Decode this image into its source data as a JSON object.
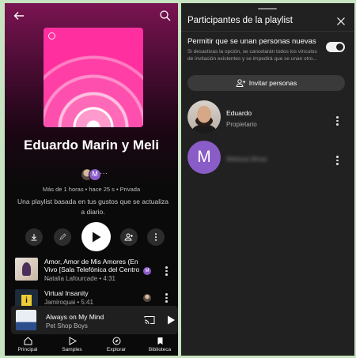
{
  "playlist_screen": {
    "title": "Eduardo Marin y Meli",
    "owner_initial": "M",
    "owners_more": "···",
    "meta": "Más de 1 horas • hace 25 s • Privada",
    "description": "Una playlist basada en tus gustos que se actualiza a diario.",
    "tracks": [
      {
        "title": "Amor, Amor de Mis Amores (En Vivo [Sala Telefónica del Centro ...",
        "subtitle": "Natalia Lafourcade • 4:31",
        "added_by_initial": "M"
      },
      {
        "title": "Virtual Insanity",
        "subtitle": "Jamiroquai • 5:41",
        "thumb_text": "i"
      }
    ],
    "mini_player": {
      "title": "Always on My Mind",
      "artist": "Pet Shop Boys"
    },
    "bottom_nav": [
      {
        "label": "Principal",
        "icon": "home-icon"
      },
      {
        "label": "Samples",
        "icon": "samples-icon"
      },
      {
        "label": "Explorar",
        "icon": "explore-icon"
      },
      {
        "label": "Biblioteca",
        "icon": "library-icon"
      }
    ]
  },
  "participants_panel": {
    "title": "Participantes de la playlist",
    "allow_label": "Permitir que se unan personas nuevas",
    "allow_note": "Si desactivas la opción, se cancelarán todos los vínculos de invitación existentes y se impedirá que se unan otro...",
    "allow_enabled": true,
    "invite_label": "Invitar personas",
    "members": [
      {
        "name": "Eduardo",
        "role": "Propietario"
      },
      {
        "initial": "M",
        "name": "Melissa Mnaz"
      }
    ]
  },
  "colors": {
    "accent_purple": "#8a5cc7",
    "cover_pink": "#ff2f9f",
    "panel_bg": "#212121"
  }
}
